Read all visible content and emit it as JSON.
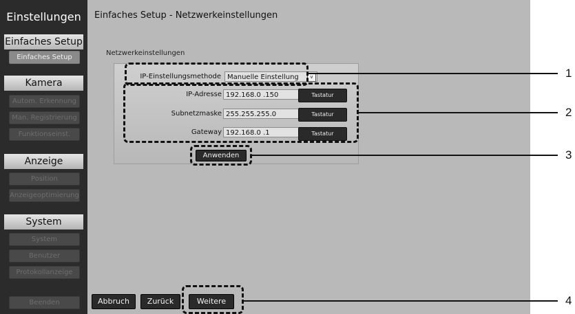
{
  "sidebar": {
    "title": "Einstellungen",
    "setup_section": "Einfaches Setup",
    "setup_button": "Einfaches Setup",
    "camera_section": "Kamera",
    "camera_items": [
      "Autom. Erkennung",
      "Man. Registrierung",
      "Funktionseinst."
    ],
    "display_section": "Anzeige",
    "display_items": [
      "Position",
      "Anzeigeoptimierung"
    ],
    "system_section": "System",
    "system_items": [
      "System",
      "Benutzer",
      "Protokollanzeige"
    ],
    "exit_button": "Beenden"
  },
  "main": {
    "page_title": "Einfaches Setup - Netzwerkeinstellungen",
    "panel_label": "Netzwerkeinstellungen",
    "ip_method_label": "IP-Einstellungsmethode",
    "ip_method_value": "Manuelle Einstellung",
    "select_arrow": "v",
    "ip_label": "IP-Adresse",
    "ip_value": "192.168.0  .150",
    "subnet_label": "Subnetzmaske",
    "subnet_value": "255.255.255.0",
    "gateway_label": "Gateway",
    "gateway_value": "192.168.0  .1",
    "keyboard_label": "Tastatur",
    "apply_button": "Anwenden",
    "cancel_button": "Abbruch",
    "back_button": "Zurück",
    "next_button": "Weitere"
  },
  "callouts": [
    "1",
    "2",
    "3",
    "4"
  ]
}
